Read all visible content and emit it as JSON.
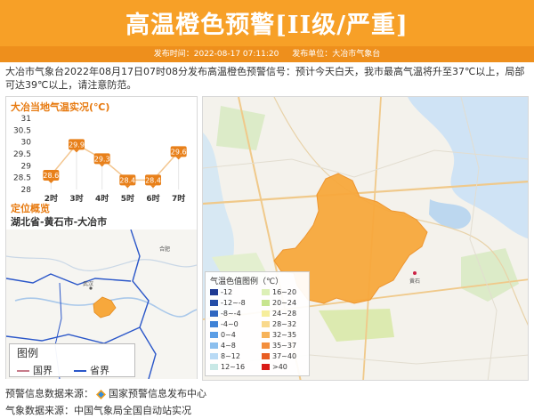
{
  "header": {
    "title": "高温橙色预警[II级/严重]",
    "publish_time_label": "发布时间：2022-08-17 07:11:20",
    "publisher_label": "发布单位：大冶市气象台"
  },
  "description": "大冶市气象台2022年08月17日07时08分发布高温橙色预警信号：预计今天白天，我市最高气温将升至37℃以上，局部可达39℃以上，请注意防范。",
  "local_temp": {
    "title": "大冶当地气温实况(℃)",
    "chart_data": {
      "type": "line",
      "categories": [
        "2时",
        "3时",
        "4时",
        "5时",
        "6时",
        "7时"
      ],
      "values": [
        28.6,
        29.9,
        29.3,
        28.4,
        28.4,
        29.6
      ],
      "y_ticks": [
        "31",
        "30.5",
        "30",
        "29.5",
        "29",
        "28.5",
        "28"
      ],
      "ylim": [
        28,
        31
      ],
      "grid": false,
      "line_color": "#f3c690",
      "label_color": "#e8801a"
    }
  },
  "location": {
    "title": "定位概览",
    "region": "湖北省-黄石市-大冶市",
    "map_labels": {
      "wuhan": "武汉",
      "hefei": "合肥",
      "huangshi": "黄石"
    },
    "legend_title": "图例",
    "legend_items": [
      {
        "label": "国界",
        "color": "#c77b8a"
      },
      {
        "label": "省界",
        "color": "#2b57c9"
      }
    ]
  },
  "temp_legend": {
    "title": "气温色值图例（℃）",
    "items": [
      {
        "label": "-12",
        "color": "#1d3a94"
      },
      {
        "label": "-12~-8",
        "color": "#234ea8"
      },
      {
        "label": "-8~-4",
        "color": "#2f66c0"
      },
      {
        "label": "-4~0",
        "color": "#3f82d6"
      },
      {
        "label": "0~4",
        "color": "#5c9ee6"
      },
      {
        "label": "4~8",
        "color": "#8cbfee"
      },
      {
        "label": "8~12",
        "color": "#b9daf5"
      },
      {
        "label": "12~16",
        "color": "#c8e8e6"
      },
      {
        "label": "16~20",
        "color": "#dcf0b6"
      },
      {
        "label": "20~24",
        "color": "#c7e58f"
      },
      {
        "label": "24~28",
        "color": "#f6ee9b"
      },
      {
        "label": "28~32",
        "color": "#f9d98c"
      },
      {
        "label": "32~35",
        "color": "#f7b35a"
      },
      {
        "label": "35~37",
        "color": "#f38e3c"
      },
      {
        "label": "37~40",
        "color": "#e85d22"
      },
      {
        "label": ">40",
        "color": "#d91b17"
      }
    ]
  },
  "footer": {
    "warning_source": "预警信息数据来源：",
    "warning_source_name": "国家预警信息发布中心",
    "weather_source": "气象数据来源：中国气象局全国自动站实况"
  },
  "colors": {
    "banner": "#f7a027",
    "meta_bar": "#ee8f1c",
    "heat_zone": "#f7a83c"
  }
}
